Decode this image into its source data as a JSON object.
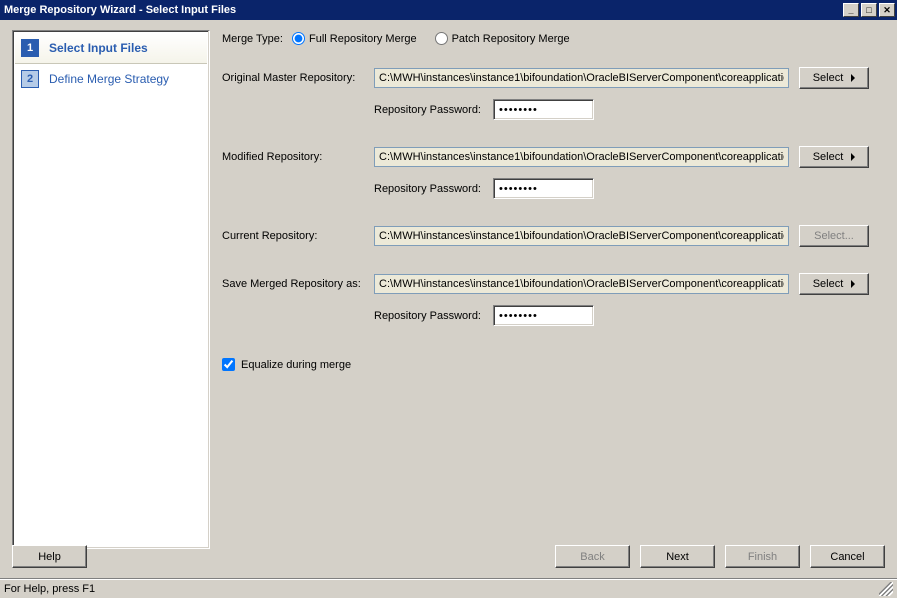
{
  "titlebar": {
    "title": "Merge Repository Wizard - Select Input Files"
  },
  "sidebar": {
    "steps": [
      {
        "num": "1",
        "label": "Select Input Files"
      },
      {
        "num": "2",
        "label": "Define Merge Strategy"
      }
    ]
  },
  "main": {
    "merge_type_label": "Merge Type:",
    "radio_full": "Full Repository Merge",
    "radio_patch": "Patch Repository Merge",
    "original": {
      "label": "Original Master Repository:",
      "path": "C:\\MWH\\instances\\instance1\\bifoundation\\OracleBIServerComponent\\coreapplicatio",
      "pwd_label": "Repository Password:",
      "pwd_value": "••••••••",
      "select_label": "Select"
    },
    "modified": {
      "label": "Modified Repository:",
      "path": "C:\\MWH\\instances\\instance1\\bifoundation\\OracleBIServerComponent\\coreapplicatio",
      "pwd_label": "Repository Password:",
      "pwd_value": "••••••••",
      "select_label": "Select"
    },
    "current": {
      "label": "Current Repository:",
      "path": "C:\\MWH\\instances\\instance1\\bifoundation\\OracleBIServerComponent\\coreapplicatio",
      "select_label": "Select..."
    },
    "save": {
      "label": "Save Merged Repository as:",
      "path": "C:\\MWH\\instances\\instance1\\bifoundation\\OracleBIServerComponent\\coreapplicatio",
      "pwd_label": "Repository Password:",
      "pwd_value": "••••••••",
      "select_label": "Select"
    },
    "equalize_label": "Equalize during merge"
  },
  "footer": {
    "help": "Help",
    "back": "Back",
    "next": "Next",
    "finish": "Finish",
    "cancel": "Cancel"
  },
  "statusbar": {
    "text": "For Help, press F1"
  }
}
